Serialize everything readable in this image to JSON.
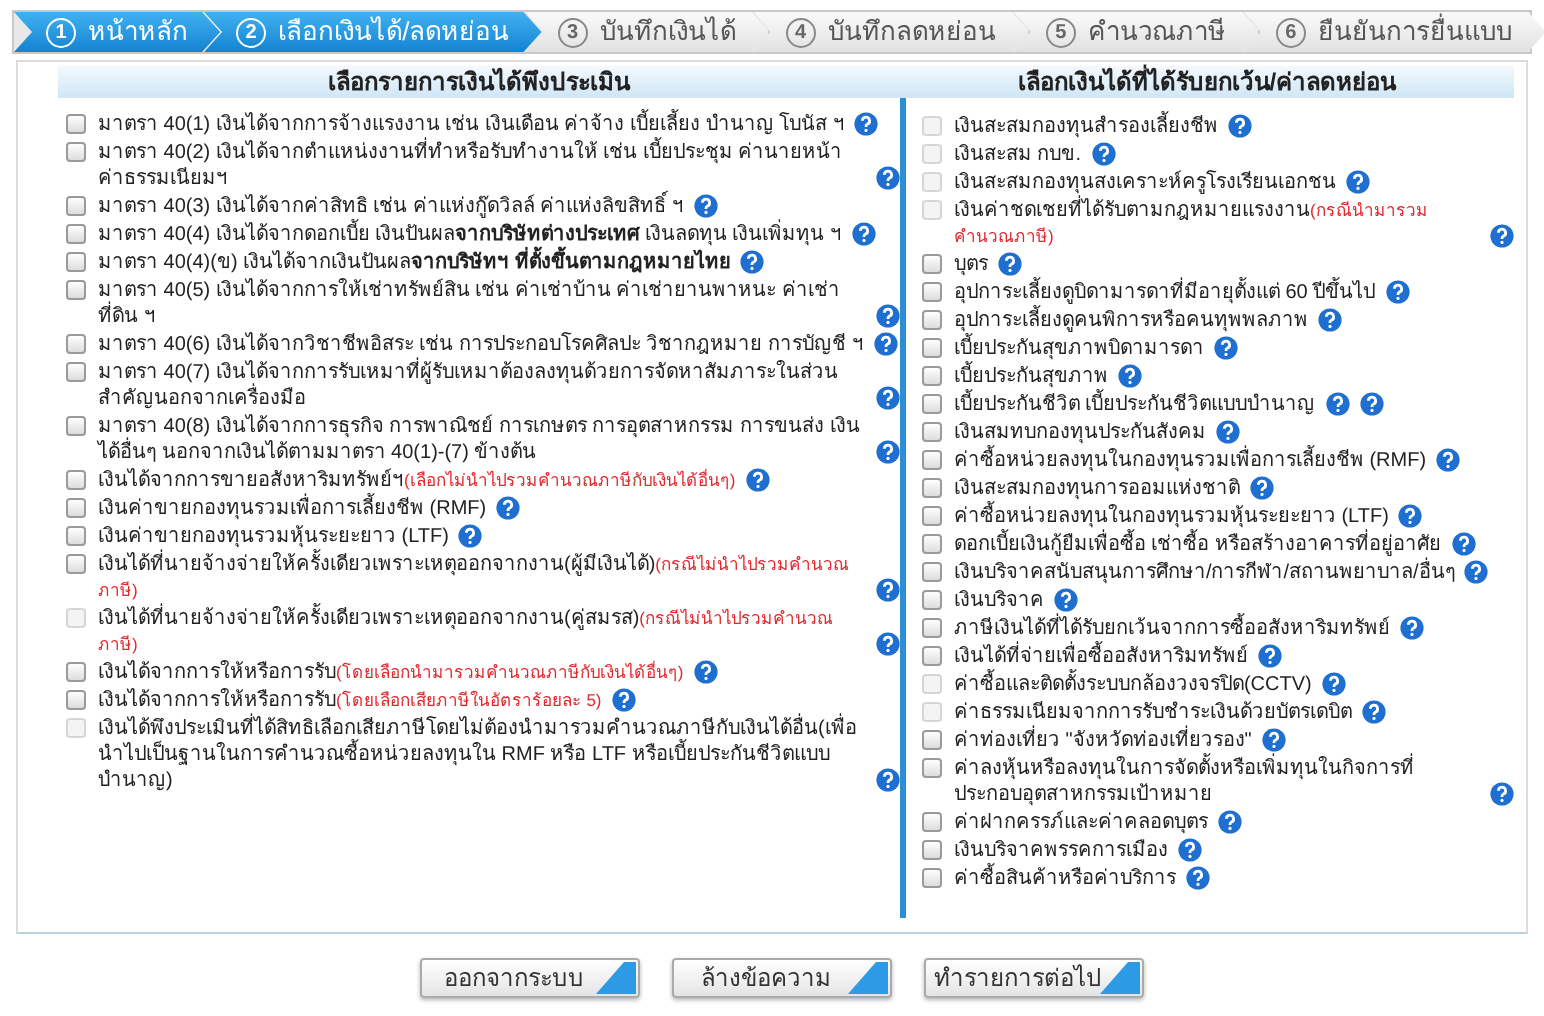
{
  "steps": [
    {
      "number": "1",
      "label": "หน้าหลัก",
      "active": true
    },
    {
      "number": "2",
      "label": "เลือกเงินได้/ลดหย่อน",
      "active": true
    },
    {
      "number": "3",
      "label": "บันทึกเงินได้",
      "active": false
    },
    {
      "number": "4",
      "label": "บันทึกลดหย่อน",
      "active": false
    },
    {
      "number": "5",
      "label": "คำนวณภาษี",
      "active": false
    },
    {
      "number": "6",
      "label": "ยืนยันการยื่นแบบ",
      "active": false
    }
  ],
  "income_panel": {
    "title": "เลือกรายการเงินได้พึงประเมิน",
    "items": [
      {
        "text": "มาตรา 40(1) เงินได้จากการจ้างแรงงาน เช่น เงินเดือน ค่าจ้าง เบี้ยเลี้ยง บำนาญ โบนัส ฯ",
        "checked": false,
        "disabled": false
      },
      {
        "text": "มาตรา 40(2) เงินได้จากตำแหน่งงานที่ทำหรือรับทำงานให้ เช่น เบี้ยประชุม ค่านายหน้า ค่าธรรมเนียมฯ",
        "checked": false,
        "disabled": false
      },
      {
        "text": "มาตรา 40(3) เงินได้จากค่าสิทธิ เช่น ค่าแห่งกู๊ดวิลล์ ค่าแห่งลิขสิทธิ์ ฯ",
        "checked": false,
        "disabled": false
      },
      {
        "text": "มาตรา 40(4) เงินได้จากดอกเบี้ย เงินปันผล**จากบริษัทต่างประเทศ** เงินลดทุน เงินเพิ่มทุน ฯ",
        "checked": false,
        "disabled": false
      },
      {
        "text": "มาตรา 40(4)(ข) เงินได้จากเงินปันผล**จากบริษัทฯ ที่ตั้งขึ้นตามกฎหมายไทย**",
        "checked": false,
        "disabled": false
      },
      {
        "text": "มาตรา 40(5) เงินได้จากการให้เช่าทรัพย์สิน เช่น ค่าเช่าบ้าน ค่าเช่ายานพาหนะ ค่าเช่าที่ดิน ฯ",
        "checked": false,
        "disabled": false
      },
      {
        "text": "มาตรา 40(6) เงินได้จากวิชาชีพอิสระ เช่น การประกอบโรคศิลปะ วิชากฎหมาย การบัญชี ฯ",
        "checked": false,
        "disabled": false
      },
      {
        "text": "มาตรา 40(7) เงินได้จากการรับเหมาที่ผู้รับเหมาต้องลงทุนด้วยการจัดหาสัมภาระในส่วนสำคัญนอกจากเครื่องมือ",
        "checked": false,
        "disabled": false
      },
      {
        "text": "มาตรา 40(8) เงินได้จากการธุรกิจ การพาณิชย์ การเกษตร การอุตสาหกรรม การขนส่ง เงินได้อื่นๆ นอกจากเงินได้ตามมาตรา 40(1)-(7) ข้างต้น",
        "checked": false,
        "disabled": false
      },
      {
        "text": "เงินได้จากการขายอสังหาริมทรัพย์ฯ",
        "note": "(เลือกไม่นำไปรวมคำนวณภาษีกับเงินได้อื่นๆ)",
        "checked": false,
        "disabled": false
      },
      {
        "text": "เงินค่าขายกองทุนรวมเพื่อการเลี้ยงชีพ (RMF)",
        "checked": false,
        "disabled": false
      },
      {
        "text": "เงินค่าขายกองทุนรวมหุ้นระยะยาว (LTF)",
        "checked": false,
        "disabled": false
      },
      {
        "text": "เงินได้ที่นายจ้างจ่ายให้ครั้งเดียวเพราะเหตุออกจากงาน(ผู้มีเงินได้)",
        "note": "(กรณีไม่นำไปรวมคำนวณภาษี)",
        "checked": false,
        "disabled": false
      },
      {
        "text": "เงินได้ที่นายจ้างจ่ายให้ครั้งเดียวเพราะเหตุออกจากงาน(คู่สมรส)",
        "note": "(กรณีไม่นำไปรวมคำนวณภาษี)",
        "checked": false,
        "disabled": true
      },
      {
        "text": "เงินได้จากการให้หรือการรับ",
        "note": "(โดยเลือกนำมารวมคำนวณภาษีกับเงินได้อื่นๆ)",
        "checked": false,
        "disabled": false
      },
      {
        "text": "เงินได้จากการให้หรือการรับ",
        "note": "(โดยเลือกเสียภาษีในอัตราร้อยละ 5)",
        "checked": false,
        "disabled": false
      },
      {
        "text": "เงินได้พึงประเมินที่ได้สิทธิเลือกเสียภาษีโดยไม่ต้องนำมารวมคำนวณภาษีกับเงินได้อื่น(เพื่อนำไปเป็นฐานในการคำนวณซื้อหน่วยลงทุนใน RMF หรือ LTF หรือเบี้ยประกันชีวิตแบบบำนาญ)",
        "checked": false,
        "disabled": true
      }
    ]
  },
  "deduction_panel": {
    "title": "เลือกเงินได้ที่ได้รับยกเว้น/ค่าลดหย่อน",
    "items": [
      {
        "text": "เงินสะสมกองทุนสำรองเลี้ยงชีพ",
        "checked": false,
        "disabled": true
      },
      {
        "text": "เงินสะสม กบข.",
        "checked": false,
        "disabled": true
      },
      {
        "text": "เงินสะสมกองทุนสงเคราะห์ครูโรงเรียนเอกชน",
        "checked": false,
        "disabled": true
      },
      {
        "text": "เงินค่าชดเชยที่ได้รับตามกฎหมายแรงงาน",
        "note": "(กรณีนำมารวมคำนวณภาษี)",
        "checked": false,
        "disabled": true
      },
      {
        "text": "บุตร",
        "checked": false,
        "disabled": false
      },
      {
        "text": "อุปการะเลี้ยงดูบิดามารดาที่มีอายุตั้งแต่ 60 ปีขึ้นไป",
        "checked": false,
        "disabled": false
      },
      {
        "text": "อุปการะเลี้ยงดูคนพิการหรือคนทุพพลภาพ",
        "checked": false,
        "disabled": false
      },
      {
        "text": "เบี้ยประกันสุขภาพบิดามารดา",
        "checked": false,
        "disabled": false
      },
      {
        "text": "เบี้ยประกันสุขภาพ",
        "checked": false,
        "disabled": false
      },
      {
        "text": "เบี้ยประกันชีวิต เบี้ยประกันชีวิตแบบบำนาญ",
        "checked": false,
        "disabled": false,
        "double_help": true
      },
      {
        "text": "เงินสมทบกองทุนประกันสังคม",
        "checked": false,
        "disabled": false
      },
      {
        "text": "ค่าซื้อหน่วยลงทุนในกองทุนรวมเพื่อการเลี้ยงชีพ (RMF)",
        "checked": false,
        "disabled": false
      },
      {
        "text": "เงินสะสมกองทุนการออมแห่งชาติ",
        "checked": false,
        "disabled": false
      },
      {
        "text": "ค่าซื้อหน่วยลงทุนในกองทุนรวมหุ้นระยะยาว (LTF)",
        "checked": false,
        "disabled": false
      },
      {
        "text": "ดอกเบี้ยเงินกู้ยืมเพื่อซื้อ เช่าซื้อ หรือสร้างอาคารที่อยู่อาศัย",
        "checked": false,
        "disabled": false
      },
      {
        "text": "เงินบริจาคสนับสนุนการศึกษา/การกีฬา/สถานพยาบาล/อื่นๆ",
        "checked": false,
        "disabled": false
      },
      {
        "text": "เงินบริจาค",
        "checked": false,
        "disabled": false
      },
      {
        "text": "ภาษีเงินได้ที่ได้รับยกเว้นจากการซื้ออสังหาริมทรัพย์",
        "checked": false,
        "disabled": false
      },
      {
        "text": "เงินได้ที่จ่ายเพื่อซื้ออสังหาริมทรัพย์",
        "checked": false,
        "disabled": false
      },
      {
        "text": "ค่าซื้อและติดตั้งระบบกล้องวงจรปิด(CCTV)",
        "checked": false,
        "disabled": true
      },
      {
        "text": "ค่าธรรมเนียมจากการรับชำระเงินด้วยบัตรเดบิต",
        "checked": false,
        "disabled": true
      },
      {
        "text": "ค่าท่องเที่ยว \"จังหวัดท่องเที่ยวรอง\"",
        "checked": false,
        "disabled": false
      },
      {
        "text": "ค่าลงหุ้นหรือลงทุนในการจัดตั้งหรือเพิ่มทุนในกิจการที่ประกอบอุตสาหกรรมเป้าหมาย",
        "checked": false,
        "disabled": false
      },
      {
        "text": "ค่าฝากครรภ์และค่าคลอดบุตร",
        "checked": false,
        "disabled": false
      },
      {
        "text": "เงินบริจาคพรรคการเมือง",
        "checked": false,
        "disabled": false
      },
      {
        "text": "ค่าซื้อสินค้าหรือค่าบริการ",
        "checked": false,
        "disabled": false
      }
    ]
  },
  "buttons": [
    "ออกจากระบบ",
    "ล้างข้อความ",
    "ทำรายการต่อไป"
  ]
}
